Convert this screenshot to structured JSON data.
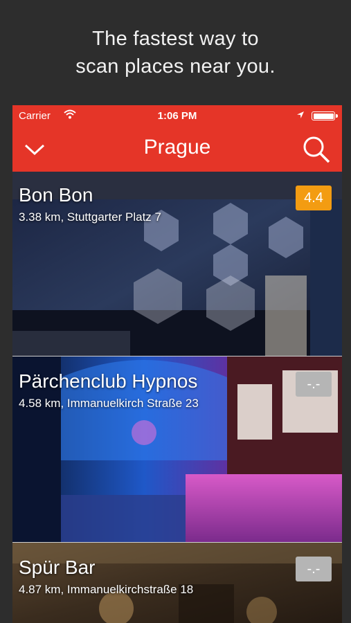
{
  "headline": {
    "line1": "The fastest way to",
    "line2": "scan places near you."
  },
  "status_bar": {
    "carrier": "Carrier",
    "time": "1:06 PM"
  },
  "nav": {
    "title": "Prague",
    "back_icon": "chevron-down-icon",
    "search_icon": "search-icon"
  },
  "places": [
    {
      "name": "Bon Bon",
      "address": "3.38 km, Stuttgarter Platz 7",
      "rating": "4.4",
      "rating_color": "#f39c12"
    },
    {
      "name": "Pärchenclub Hypnos",
      "address": "4.58 km, Immanuelkirch Straße 23",
      "rating": "-.-",
      "rating_color": "#b5b5b5"
    },
    {
      "name": "Spür Bar",
      "address": "4.87 km, Immanuelkirchstraße 18",
      "rating": "-.-",
      "rating_color": "#b5b5b5"
    }
  ],
  "colors": {
    "accent": "#e53528",
    "background": "#2d2d2d"
  }
}
